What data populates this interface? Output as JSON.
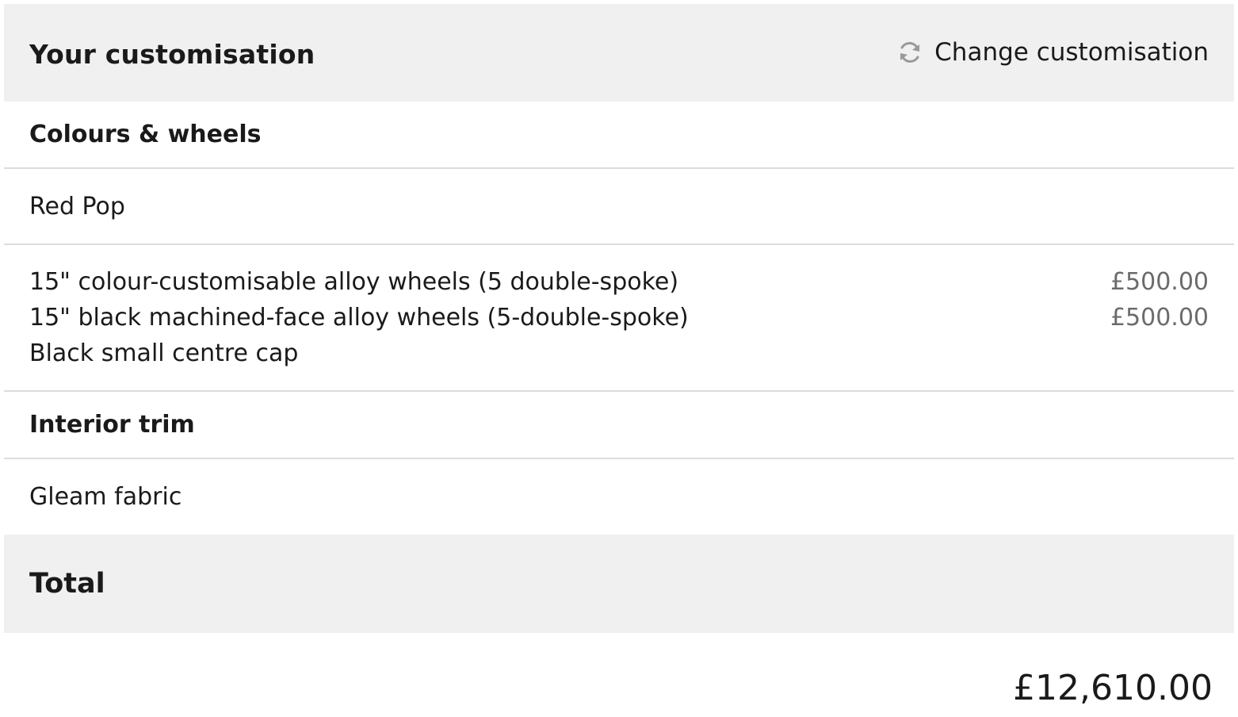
{
  "header": {
    "title": "Your customisation",
    "change_label": "Change customisation",
    "change_icon": "refresh-icon"
  },
  "sections": {
    "colours": {
      "heading": "Colours & wheels",
      "paint": "Red Pop",
      "wheels": [
        {
          "name": "15\" colour-customisable alloy wheels (5 double-spoke)",
          "price": "£500.00"
        },
        {
          "name": "15\" black machined-face alloy wheels (5-double-spoke)",
          "price": "£500.00"
        },
        {
          "name": "Black small centre cap",
          "price": ""
        }
      ]
    },
    "interior": {
      "heading": "Interior trim",
      "item": "Gleam fabric"
    }
  },
  "total": {
    "label": "Total",
    "amount": "£12,610.00"
  },
  "colors": {
    "header_bg": "#f0f0f0",
    "divider": "#dcdcdc",
    "price_text": "#6b6b6b",
    "text": "#1a1a1a"
  }
}
